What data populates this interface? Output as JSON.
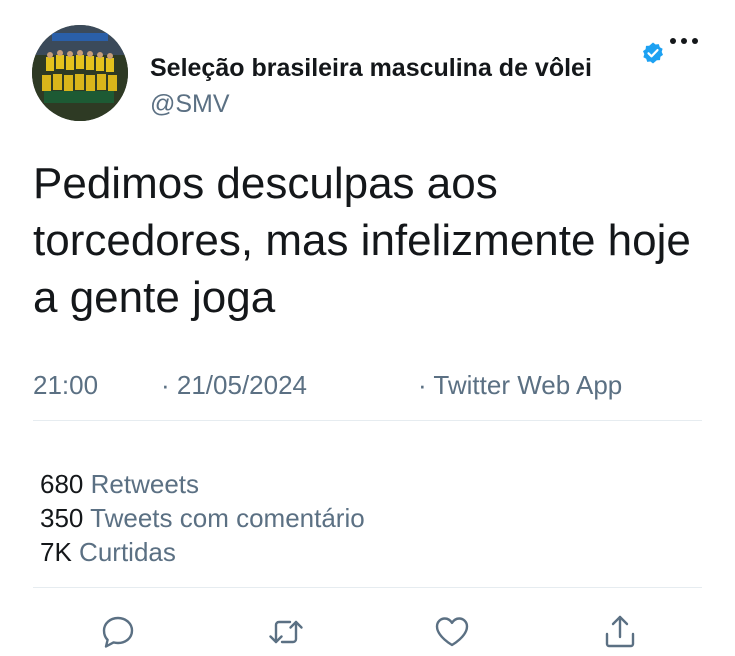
{
  "tweet": {
    "display_name": "Seleção brasileira masculina de vôlei",
    "handle": "@SMV",
    "verified_icon": "verified-badge-icon",
    "text": "Pedimos desculpas aos torcedores, mas infelizmente hoje a gente joga",
    "time": "21:00",
    "date": "· 21/05/2024",
    "source": "· Twitter Web App"
  },
  "stats": [
    {
      "count": "680",
      "label": "Retweets"
    },
    {
      "count": "350",
      "label": "Tweets com comentário"
    },
    {
      "count": "7K",
      "label": "Curtidas"
    }
  ],
  "actions": {
    "reply_icon": "reply-icon",
    "retweet_icon": "retweet-icon",
    "like_icon": "like-icon",
    "share_icon": "share-icon"
  },
  "colors": {
    "text": "#14171a",
    "secondary": "#5b7083",
    "verified": "#1da1f2",
    "divider": "#e6ecf0"
  }
}
